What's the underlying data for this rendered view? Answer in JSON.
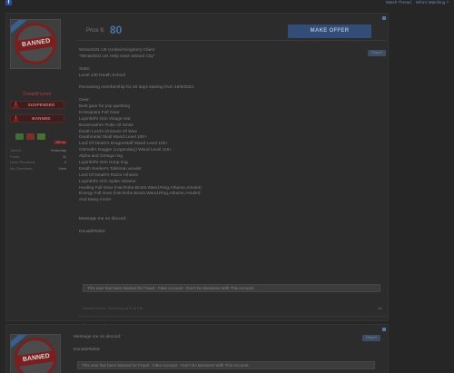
{
  "topbar": {
    "links": [
      "Watch Thread",
      "Who's Watching ?"
    ]
  },
  "post1": {
    "avatar_text": "BANNED",
    "username": "DonaldHurner",
    "banner_suspended": "SUSPENDED",
    "banner_banned": "BANNED",
    "pill": "289 tra",
    "stats": [
      {
        "k": "Joined:",
        "v": "Yesterday"
      },
      {
        "k": "Posts:",
        "v": "11"
      },
      {
        "k": "Likes Received:",
        "v": "0"
      },
      {
        "k": "My Cannibals:",
        "v": "View"
      }
    ],
    "price_label": "Price $:",
    "price_value": "80",
    "make_offer": "MAKE OFFER",
    "report": "Report",
    "body_lines": [
      "Wizard101 UK (United Kingdom) Client",
      "\"Wizard101 UK Help Save Wizard City\"",
      "",
      "Stats:",
      "Level 130 Death School",
      "",
      "Remaining membership for 20 days starting from 16/5/2021",
      "",
      "Gear:",
      "Best gear for pvp questing",
      "Krokopatra Full Gear",
      "Lupinfell's Grin Visage Hat",
      "Bonemasher Robe Of Smite",
      "Death Lord's Greaves Of Woe",
      "Deathmetal Skull Wand Level 100+",
      "Lord Of Death's Dragonstaff Wand Level 100+",
      "Gismalt's Dagger (Legendary) Wand Level 115+",
      "Alpha and Omega ring",
      "Lupinfell's Grin Hoop ring",
      "Death Seeker's Talisman amulet",
      "Lord Of Death's Razor Athame",
      "Lupinfell's Grin Spike Athame",
      "Healing Full Gear (Hat,Robe,Boots,Wand,Ring,Athame,Amulet)",
      "Energy Full Gear (Hat,Robe,Boots,Wand,Ring,Athame,Amulet)",
      "And Many more!",
      "",
      "",
      "Message me on discord:",
      "",
      "Donald#5353"
    ],
    "notice": "This user has been banned for Fraud - Fake Account - Don't Do Business With This Account.",
    "meta": "Donald Hurner, Yesterday at 5:35 PM",
    "post_num": "#1",
    "actions": [
      "Report",
      "Bookmark"
    ],
    "like": "Like"
  },
  "post2": {
    "avatar_text": "BANNED",
    "line1": "Message me on discord:",
    "line2": "Donald#5353",
    "report": "Report",
    "notice": "This user has been banned for Fraud - Fake Account - Don't Do Business With This Account."
  }
}
